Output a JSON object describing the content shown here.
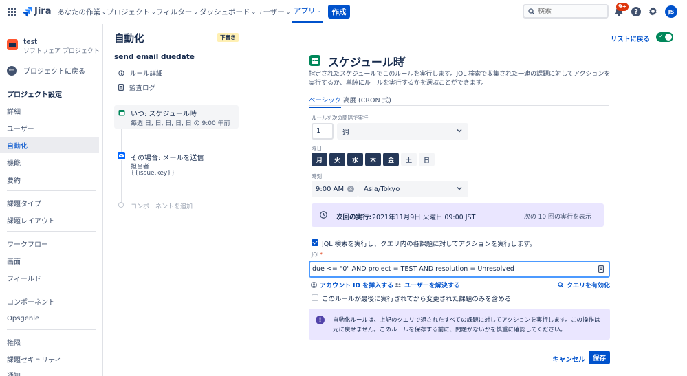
{
  "topnav": {
    "product": "Jira",
    "menus": [
      {
        "label": "あなたの作業"
      },
      {
        "label": "プロジェクト"
      },
      {
        "label": "フィルター"
      },
      {
        "label": "ダッシュボード"
      },
      {
        "label": "ユーザー"
      },
      {
        "label": "アプリ"
      }
    ],
    "create_label": "作成",
    "search_placeholder": "検索",
    "notification_count": "9+",
    "avatar_initials": "JS"
  },
  "sidebar": {
    "project_name": "test",
    "project_type": "ソフトウェア プロジェクト",
    "back_label": "プロジェクトに戻る",
    "section_title": "プロジェクト設定",
    "items": [
      "詳細",
      "ユーザー",
      "自動化",
      "機能",
      "要約",
      "課題タイプ",
      "課題レイアウト",
      "ワークフロー",
      "画面",
      "フィールド",
      "コンポーネント",
      "Opsgenie",
      "権限",
      "課題セキュリティ",
      "通知"
    ]
  },
  "rule": {
    "page_title": "自動化",
    "status_badge": "下書き",
    "name": "send email duedate",
    "links": [
      "ルール詳細",
      "監査ログ"
    ],
    "trigger_title": "いつ: スケジュール時",
    "trigger_sub": "毎週 日, 日, 日, 日, 日 の 9:00 午前",
    "action_title": "その場合: メールを送信",
    "action_sub1": "担当者",
    "action_sub2": "{{issue.key}}",
    "add_component": "コンポーネントを追加"
  },
  "header": {
    "back_to_list": "リストに戻る"
  },
  "schedule": {
    "title": "スケジュール時",
    "description": "指定されたスケジュールでこのルールを実行します。JQL 検索で収集された一連の課題に対してアクションを実行するか、単純にルールを実行するかを選ぶことができます。",
    "tabs": [
      "ベーシック",
      "高度 (CRON 式)"
    ],
    "interval_label": "ルールを次の間隔で実行",
    "interval_value": "1",
    "interval_unit": "週",
    "weekday_label": "曜日",
    "days": [
      {
        "label": "月",
        "selected": true
      },
      {
        "label": "火",
        "selected": true
      },
      {
        "label": "水",
        "selected": true
      },
      {
        "label": "木",
        "selected": true
      },
      {
        "label": "金",
        "selected": true
      },
      {
        "label": "土",
        "selected": false
      },
      {
        "label": "日",
        "selected": false
      }
    ],
    "time_label": "時刻",
    "time_value": "9:00 AM",
    "timezone": "Asia/Tokyo",
    "next_run_label": "次回の実行:",
    "next_run_value": "2021年11月9日 火曜日 09:00 JST",
    "next_run_link": "次の 10 回の実行を表示",
    "jql_checkbox_label": "JQL 検索を実行し、クエリ内の各課題に対してアクションを実行します。",
    "jql_label": "JQL",
    "jql_value": "due <= \"0\" AND project = TEST AND resolution = Unresolved",
    "insert_account": "アカウント ID を挿入する",
    "resolve_user": "ユーザーを解決する",
    "validate_query": "クエリを有効化",
    "changed_only_label": "このルールが最後に実行されてから変更された課題のみを含める",
    "warning_text": "自動化ルールは、上記のクエリで返されたすべての課題に対してアクションを実行します。この操作は元に戻せません。このルールを保存する前に、問題がないかを慎重に確認してください。",
    "cancel_label": "キャンセル",
    "save_label": "保存"
  },
  "colors": {
    "primary": "#0052cc",
    "selected_day": "#253858",
    "info_bg": "#eae6ff",
    "toggle_on": "#00875a"
  }
}
